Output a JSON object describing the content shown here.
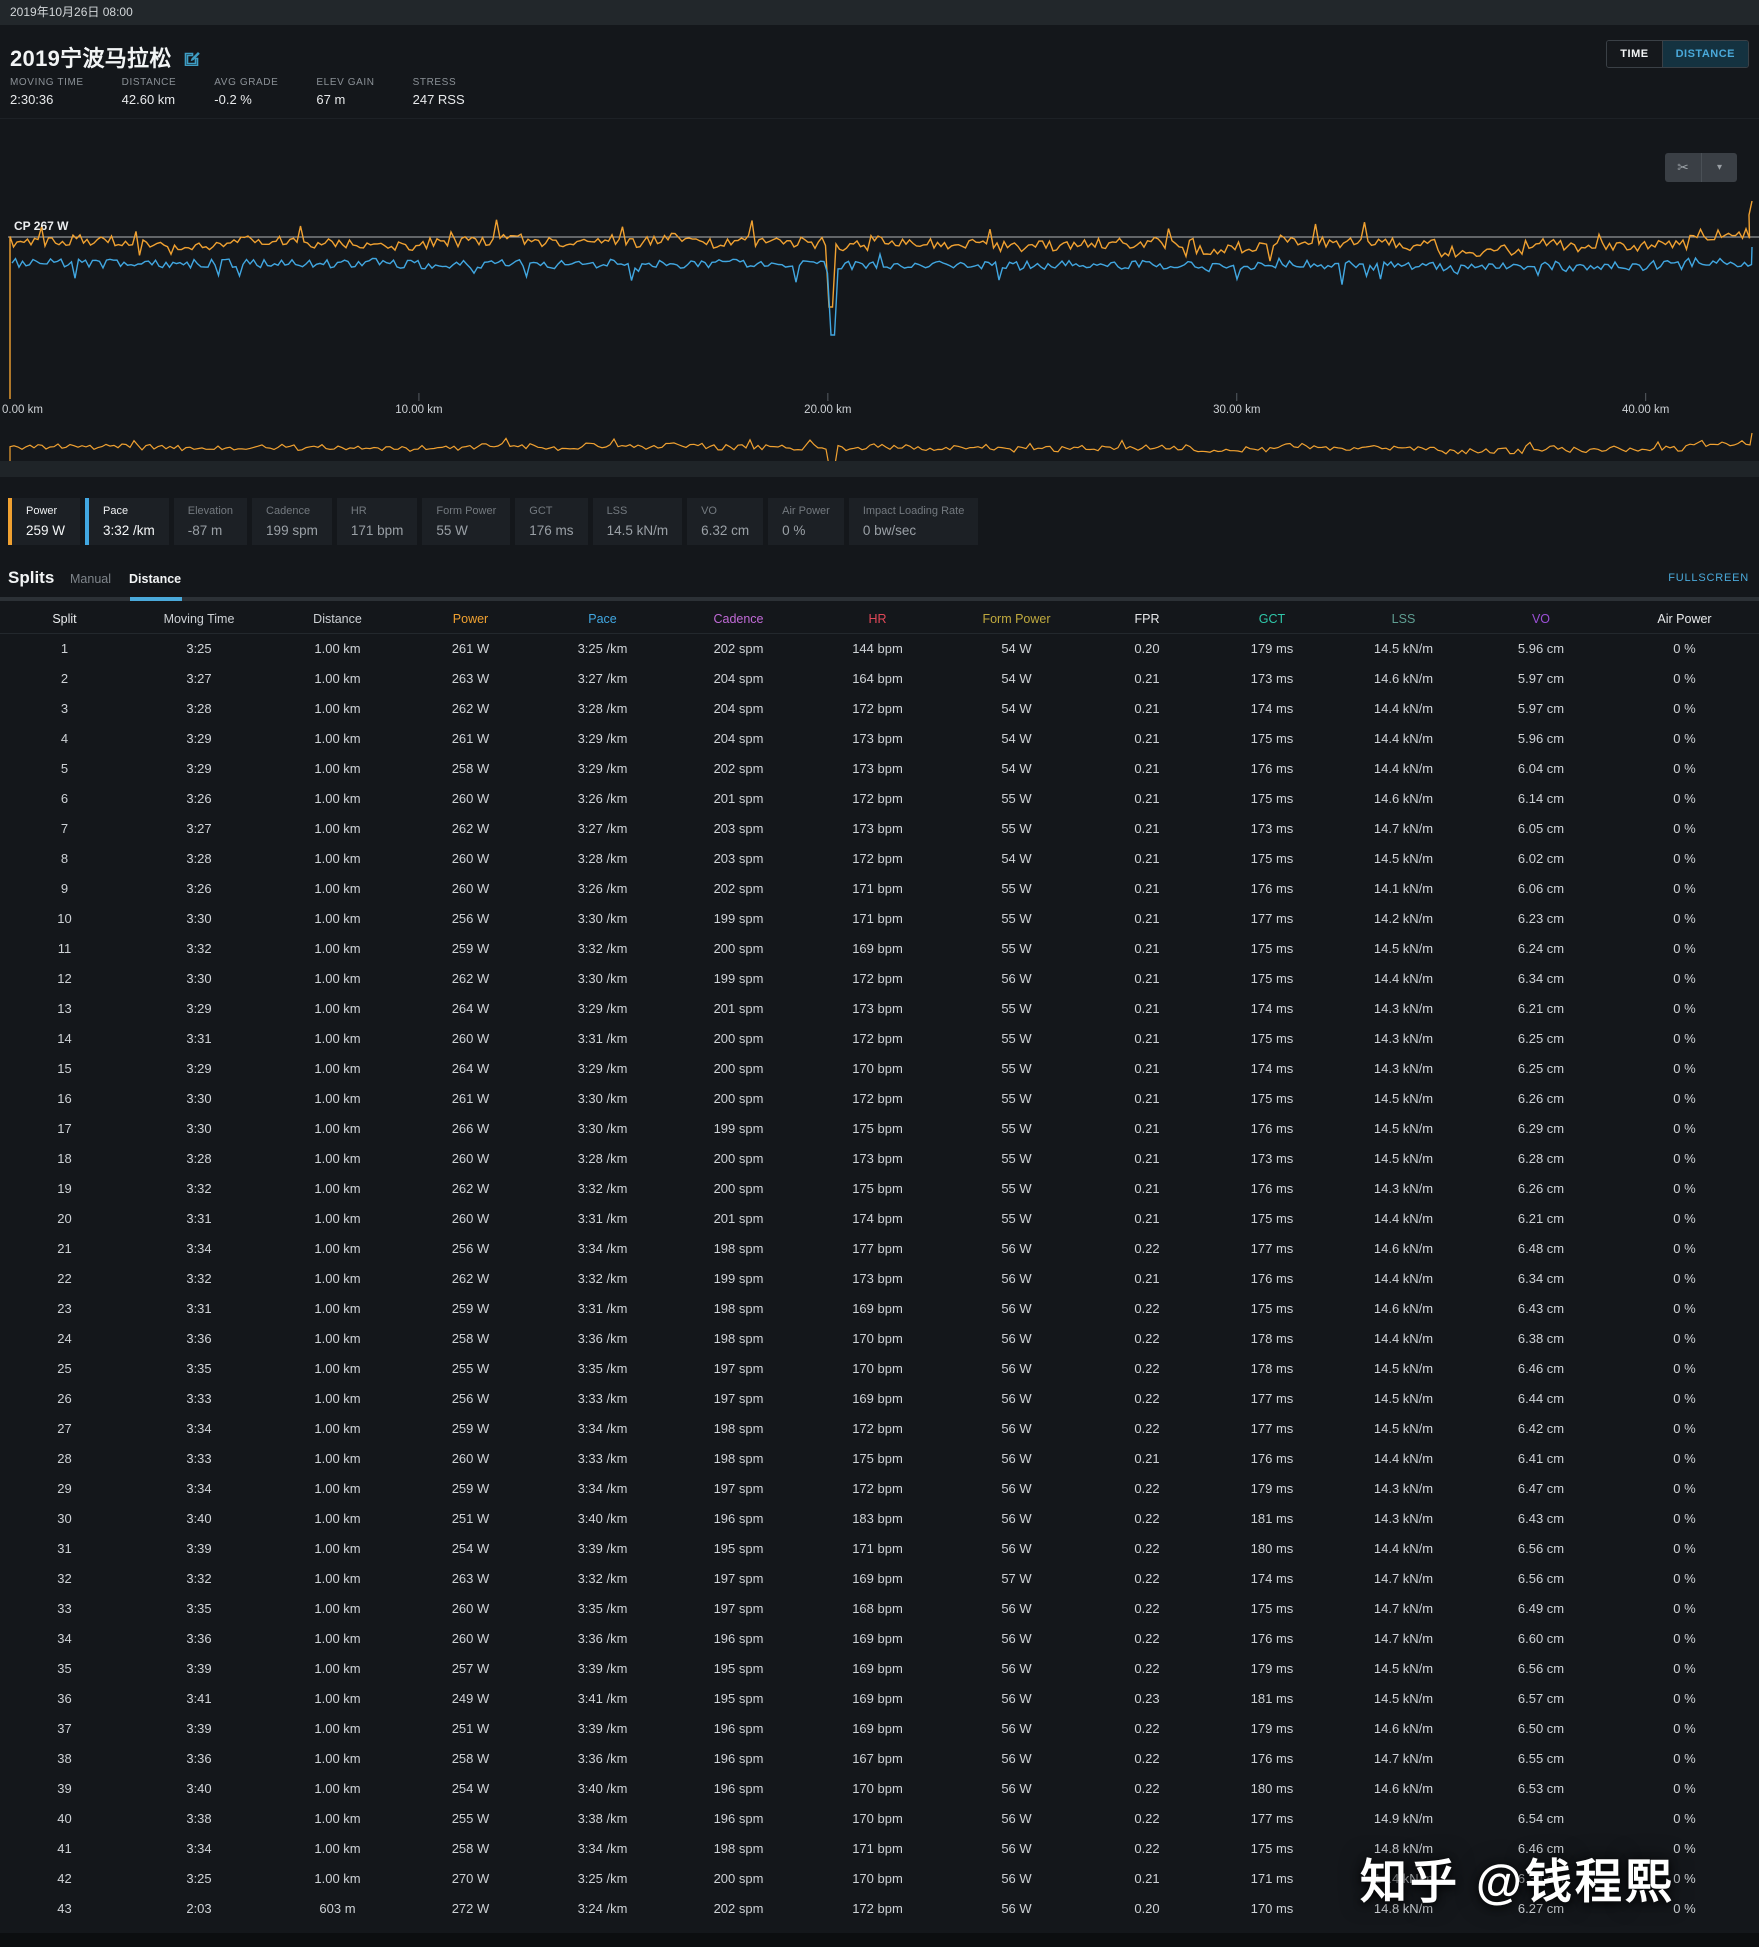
{
  "top_bar": {
    "datetime": "2019年10月26日 08:00"
  },
  "header": {
    "title": "2019宁波马拉松",
    "view_toggle": [
      {
        "label": "TIME",
        "active": false
      },
      {
        "label": "DISTANCE",
        "active": true
      }
    ],
    "stats": [
      {
        "label": "MOVING TIME",
        "value": "2:30:36"
      },
      {
        "label": "DISTANCE",
        "value": "42.60 km"
      },
      {
        "label": "AVG GRADE",
        "value": "-0.2 %"
      },
      {
        "label": "ELEV GAIN",
        "value": "67 m"
      },
      {
        "label": "STRESS",
        "value": "247 RSS"
      }
    ]
  },
  "chart_data": {
    "type": "line",
    "title": "",
    "x_axis": {
      "ticks": [
        "0.00 km",
        "10.00 km",
        "20.00 km",
        "30.00 km",
        "40.00 km"
      ],
      "tick_km": [
        0,
        10,
        20,
        30,
        40
      ],
      "range_km": [
        0,
        42.6
      ]
    },
    "reference_line": {
      "label": "CP 267 W",
      "watts": 267
    },
    "grid": false,
    "legend_position": "none",
    "series": [
      {
        "name": "Power",
        "unit": "W",
        "color": "#f0a131",
        "avg": 259,
        "per_km_values": [
          261,
          263,
          262,
          261,
          258,
          260,
          262,
          260,
          260,
          256,
          259,
          262,
          264,
          260,
          264,
          261,
          266,
          260,
          262,
          260,
          256,
          262,
          259,
          258,
          255,
          256,
          259,
          260,
          259,
          251,
          254,
          263,
          260,
          260,
          257,
          249,
          251,
          258,
          254,
          255,
          258,
          270,
          272
        ]
      },
      {
        "name": "Pace",
        "unit": "sec/km",
        "color": "#41a7e1",
        "avg": "3:32 /km",
        "per_km_values": [
          205,
          207,
          208,
          209,
          209,
          206,
          207,
          208,
          206,
          210,
          212,
          210,
          209,
          211,
          209,
          210,
          210,
          208,
          212,
          211,
          214,
          212,
          211,
          216,
          215,
          213,
          214,
          213,
          214,
          220,
          219,
          212,
          215,
          216,
          219,
          221,
          219,
          216,
          220,
          218,
          214,
          205,
          204
        ]
      }
    ],
    "anomaly": {
      "km": 20.1,
      "note": "sharp downward dropout spike in both traces"
    },
    "mini_chart": {
      "series": "Power",
      "color": "#f0a131"
    }
  },
  "metric_buttons": [
    {
      "label": "Power",
      "value": "259 W",
      "active": true,
      "accent": "#f0a131"
    },
    {
      "label": "Pace",
      "value": "3:32 /km",
      "active": true,
      "accent": "#41a7e1"
    },
    {
      "label": "Elevation",
      "value": "-87 m",
      "active": false
    },
    {
      "label": "Cadence",
      "value": "199 spm",
      "active": false
    },
    {
      "label": "HR",
      "value": "171 bpm",
      "active": false
    },
    {
      "label": "Form Power",
      "value": "55 W",
      "active": false
    },
    {
      "label": "GCT",
      "value": "176 ms",
      "active": false
    },
    {
      "label": "LSS",
      "value": "14.5 kN/m",
      "active": false
    },
    {
      "label": "VO",
      "value": "6.32 cm",
      "active": false
    },
    {
      "label": "Air Power",
      "value": "0 %",
      "active": false
    },
    {
      "label": "Impact Loading Rate",
      "value": "0 bw/sec",
      "active": false
    }
  ],
  "splits": {
    "title": "Splits",
    "tabs": [
      {
        "label": "Manual",
        "active": false
      },
      {
        "label": "Distance",
        "active": true
      }
    ],
    "fullscreen_label": "FULLSCREEN",
    "columns": [
      {
        "label": "Split",
        "color": "#e9ebed"
      },
      {
        "label": "Moving Time",
        "color": "#cdd1d5"
      },
      {
        "label": "Distance",
        "color": "#cdd1d5"
      },
      {
        "label": "Power",
        "color": "#f0a131"
      },
      {
        "label": "Pace",
        "color": "#41a7e1"
      },
      {
        "label": "Cadence",
        "color": "#c06ad6"
      },
      {
        "label": "HR",
        "color": "#e04858"
      },
      {
        "label": "Form Power",
        "color": "#bfa93e"
      },
      {
        "label": "FPR",
        "color": "#e9ebed"
      },
      {
        "label": "GCT",
        "color": "#2fc7a9"
      },
      {
        "label": "LSS",
        "color": "#5f9e92"
      },
      {
        "label": "VO",
        "color": "#9b4fd6"
      },
      {
        "label": "Air Power",
        "color": "#e9ebed"
      }
    ],
    "rows": [
      [
        "1",
        "3:25",
        "1.00 km",
        "261 W",
        "3:25 /km",
        "202 spm",
        "144 bpm",
        "54 W",
        "0.20",
        "179 ms",
        "14.5 kN/m",
        "5.96 cm",
        "0 %"
      ],
      [
        "2",
        "3:27",
        "1.00 km",
        "263 W",
        "3:27 /km",
        "204 spm",
        "164 bpm",
        "54 W",
        "0.21",
        "173 ms",
        "14.6 kN/m",
        "5.97 cm",
        "0 %"
      ],
      [
        "3",
        "3:28",
        "1.00 km",
        "262 W",
        "3:28 /km",
        "204 spm",
        "172 bpm",
        "54 W",
        "0.21",
        "174 ms",
        "14.4 kN/m",
        "5.97 cm",
        "0 %"
      ],
      [
        "4",
        "3:29",
        "1.00 km",
        "261 W",
        "3:29 /km",
        "204 spm",
        "173 bpm",
        "54 W",
        "0.21",
        "175 ms",
        "14.4 kN/m",
        "5.96 cm",
        "0 %"
      ],
      [
        "5",
        "3:29",
        "1.00 km",
        "258 W",
        "3:29 /km",
        "202 spm",
        "173 bpm",
        "54 W",
        "0.21",
        "176 ms",
        "14.4 kN/m",
        "6.04 cm",
        "0 %"
      ],
      [
        "6",
        "3:26",
        "1.00 km",
        "260 W",
        "3:26 /km",
        "201 spm",
        "172 bpm",
        "55 W",
        "0.21",
        "175 ms",
        "14.6 kN/m",
        "6.14 cm",
        "0 %"
      ],
      [
        "7",
        "3:27",
        "1.00 km",
        "262 W",
        "3:27 /km",
        "203 spm",
        "173 bpm",
        "55 W",
        "0.21",
        "173 ms",
        "14.7 kN/m",
        "6.05 cm",
        "0 %"
      ],
      [
        "8",
        "3:28",
        "1.00 km",
        "260 W",
        "3:28 /km",
        "203 spm",
        "172 bpm",
        "54 W",
        "0.21",
        "175 ms",
        "14.5 kN/m",
        "6.02 cm",
        "0 %"
      ],
      [
        "9",
        "3:26",
        "1.00 km",
        "260 W",
        "3:26 /km",
        "202 spm",
        "171 bpm",
        "55 W",
        "0.21",
        "176 ms",
        "14.1 kN/m",
        "6.06 cm",
        "0 %"
      ],
      [
        "10",
        "3:30",
        "1.00 km",
        "256 W",
        "3:30 /km",
        "199 spm",
        "171 bpm",
        "55 W",
        "0.21",
        "177 ms",
        "14.2 kN/m",
        "6.23 cm",
        "0 %"
      ],
      [
        "11",
        "3:32",
        "1.00 km",
        "259 W",
        "3:32 /km",
        "200 spm",
        "169 bpm",
        "55 W",
        "0.21",
        "175 ms",
        "14.5 kN/m",
        "6.24 cm",
        "0 %"
      ],
      [
        "12",
        "3:30",
        "1.00 km",
        "262 W",
        "3:30 /km",
        "199 spm",
        "172 bpm",
        "56 W",
        "0.21",
        "175 ms",
        "14.4 kN/m",
        "6.34 cm",
        "0 %"
      ],
      [
        "13",
        "3:29",
        "1.00 km",
        "264 W",
        "3:29 /km",
        "201 spm",
        "173 bpm",
        "55 W",
        "0.21",
        "174 ms",
        "14.3 kN/m",
        "6.21 cm",
        "0 %"
      ],
      [
        "14",
        "3:31",
        "1.00 km",
        "260 W",
        "3:31 /km",
        "200 spm",
        "172 bpm",
        "55 W",
        "0.21",
        "175 ms",
        "14.3 kN/m",
        "6.25 cm",
        "0 %"
      ],
      [
        "15",
        "3:29",
        "1.00 km",
        "264 W",
        "3:29 /km",
        "200 spm",
        "170 bpm",
        "55 W",
        "0.21",
        "174 ms",
        "14.3 kN/m",
        "6.25 cm",
        "0 %"
      ],
      [
        "16",
        "3:30",
        "1.00 km",
        "261 W",
        "3:30 /km",
        "200 spm",
        "172 bpm",
        "55 W",
        "0.21",
        "175 ms",
        "14.5 kN/m",
        "6.26 cm",
        "0 %"
      ],
      [
        "17",
        "3:30",
        "1.00 km",
        "266 W",
        "3:30 /km",
        "199 spm",
        "175 bpm",
        "55 W",
        "0.21",
        "176 ms",
        "14.5 kN/m",
        "6.29 cm",
        "0 %"
      ],
      [
        "18",
        "3:28",
        "1.00 km",
        "260 W",
        "3:28 /km",
        "200 spm",
        "173 bpm",
        "55 W",
        "0.21",
        "173 ms",
        "14.5 kN/m",
        "6.28 cm",
        "0 %"
      ],
      [
        "19",
        "3:32",
        "1.00 km",
        "262 W",
        "3:32 /km",
        "200 spm",
        "175 bpm",
        "55 W",
        "0.21",
        "176 ms",
        "14.3 kN/m",
        "6.26 cm",
        "0 %"
      ],
      [
        "20",
        "3:31",
        "1.00 km",
        "260 W",
        "3:31 /km",
        "201 spm",
        "174 bpm",
        "55 W",
        "0.21",
        "175 ms",
        "14.4 kN/m",
        "6.21 cm",
        "0 %"
      ],
      [
        "21",
        "3:34",
        "1.00 km",
        "256 W",
        "3:34 /km",
        "198 spm",
        "177 bpm",
        "56 W",
        "0.22",
        "177 ms",
        "14.6 kN/m",
        "6.48 cm",
        "0 %"
      ],
      [
        "22",
        "3:32",
        "1.00 km",
        "262 W",
        "3:32 /km",
        "199 spm",
        "173 bpm",
        "56 W",
        "0.21",
        "176 ms",
        "14.4 kN/m",
        "6.34 cm",
        "0 %"
      ],
      [
        "23",
        "3:31",
        "1.00 km",
        "259 W",
        "3:31 /km",
        "198 spm",
        "169 bpm",
        "56 W",
        "0.22",
        "175 ms",
        "14.6 kN/m",
        "6.43 cm",
        "0 %"
      ],
      [
        "24",
        "3:36",
        "1.00 km",
        "258 W",
        "3:36 /km",
        "198 spm",
        "170 bpm",
        "56 W",
        "0.22",
        "178 ms",
        "14.4 kN/m",
        "6.38 cm",
        "0 %"
      ],
      [
        "25",
        "3:35",
        "1.00 km",
        "255 W",
        "3:35 /km",
        "197 spm",
        "170 bpm",
        "56 W",
        "0.22",
        "178 ms",
        "14.5 kN/m",
        "6.46 cm",
        "0 %"
      ],
      [
        "26",
        "3:33",
        "1.00 km",
        "256 W",
        "3:33 /km",
        "197 spm",
        "169 bpm",
        "56 W",
        "0.22",
        "177 ms",
        "14.5 kN/m",
        "6.44 cm",
        "0 %"
      ],
      [
        "27",
        "3:34",
        "1.00 km",
        "259 W",
        "3:34 /km",
        "198 spm",
        "172 bpm",
        "56 W",
        "0.22",
        "177 ms",
        "14.5 kN/m",
        "6.42 cm",
        "0 %"
      ],
      [
        "28",
        "3:33",
        "1.00 km",
        "260 W",
        "3:33 /km",
        "198 spm",
        "175 bpm",
        "56 W",
        "0.21",
        "176 ms",
        "14.4 kN/m",
        "6.41 cm",
        "0 %"
      ],
      [
        "29",
        "3:34",
        "1.00 km",
        "259 W",
        "3:34 /km",
        "197 spm",
        "172 bpm",
        "56 W",
        "0.22",
        "179 ms",
        "14.3 kN/m",
        "6.47 cm",
        "0 %"
      ],
      [
        "30",
        "3:40",
        "1.00 km",
        "251 W",
        "3:40 /km",
        "196 spm",
        "183 bpm",
        "56 W",
        "0.22",
        "181 ms",
        "14.3 kN/m",
        "6.43 cm",
        "0 %"
      ],
      [
        "31",
        "3:39",
        "1.00 km",
        "254 W",
        "3:39 /km",
        "195 spm",
        "171 bpm",
        "56 W",
        "0.22",
        "180 ms",
        "14.4 kN/m",
        "6.56 cm",
        "0 %"
      ],
      [
        "32",
        "3:32",
        "1.00 km",
        "263 W",
        "3:32 /km",
        "197 spm",
        "169 bpm",
        "57 W",
        "0.22",
        "174 ms",
        "14.7 kN/m",
        "6.56 cm",
        "0 %"
      ],
      [
        "33",
        "3:35",
        "1.00 km",
        "260 W",
        "3:35 /km",
        "197 spm",
        "168 bpm",
        "56 W",
        "0.22",
        "175 ms",
        "14.7 kN/m",
        "6.49 cm",
        "0 %"
      ],
      [
        "34",
        "3:36",
        "1.00 km",
        "260 W",
        "3:36 /km",
        "196 spm",
        "169 bpm",
        "56 W",
        "0.22",
        "176 ms",
        "14.7 kN/m",
        "6.60 cm",
        "0 %"
      ],
      [
        "35",
        "3:39",
        "1.00 km",
        "257 W",
        "3:39 /km",
        "195 spm",
        "169 bpm",
        "56 W",
        "0.22",
        "179 ms",
        "14.5 kN/m",
        "6.56 cm",
        "0 %"
      ],
      [
        "36",
        "3:41",
        "1.00 km",
        "249 W",
        "3:41 /km",
        "195 spm",
        "169 bpm",
        "56 W",
        "0.23",
        "181 ms",
        "14.5 kN/m",
        "6.57 cm",
        "0 %"
      ],
      [
        "37",
        "3:39",
        "1.00 km",
        "251 W",
        "3:39 /km",
        "196 spm",
        "169 bpm",
        "56 W",
        "0.22",
        "179 ms",
        "14.6 kN/m",
        "6.50 cm",
        "0 %"
      ],
      [
        "38",
        "3:36",
        "1.00 km",
        "258 W",
        "3:36 /km",
        "196 spm",
        "167 bpm",
        "56 W",
        "0.22",
        "176 ms",
        "14.7 kN/m",
        "6.55 cm",
        "0 %"
      ],
      [
        "39",
        "3:40",
        "1.00 km",
        "254 W",
        "3:40 /km",
        "196 spm",
        "170 bpm",
        "56 W",
        "0.22",
        "180 ms",
        "14.6 kN/m",
        "6.53 cm",
        "0 %"
      ],
      [
        "40",
        "3:38",
        "1.00 km",
        "255 W",
        "3:38 /km",
        "196 spm",
        "170 bpm",
        "56 W",
        "0.22",
        "177 ms",
        "14.9 kN/m",
        "6.54 cm",
        "0 %"
      ],
      [
        "41",
        "3:34",
        "1.00 km",
        "258 W",
        "3:34 /km",
        "198 spm",
        "171 bpm",
        "56 W",
        "0.22",
        "175 ms",
        "14.8 kN/m",
        "6.46 cm",
        "0 %"
      ],
      [
        "42",
        "3:25",
        "1.00 km",
        "270 W",
        "3:25 /km",
        "200 spm",
        "170 bpm",
        "56 W",
        "0.21",
        "171 ms",
        "14.4 kN/m",
        "6.34 cm",
        "0 %"
      ],
      [
        "43",
        "2:03",
        "603 m",
        "272 W",
        "3:24 /km",
        "202 spm",
        "172 bpm",
        "56 W",
        "0.20",
        "170 ms",
        "14.8 kN/m",
        "6.27 cm",
        "0 %"
      ]
    ]
  },
  "watermark": "知乎 @钱程熙",
  "colors": {
    "accent_blue": "#4aa9da",
    "accent_orange": "#f0a131",
    "cp_line": "#d7dadc"
  }
}
